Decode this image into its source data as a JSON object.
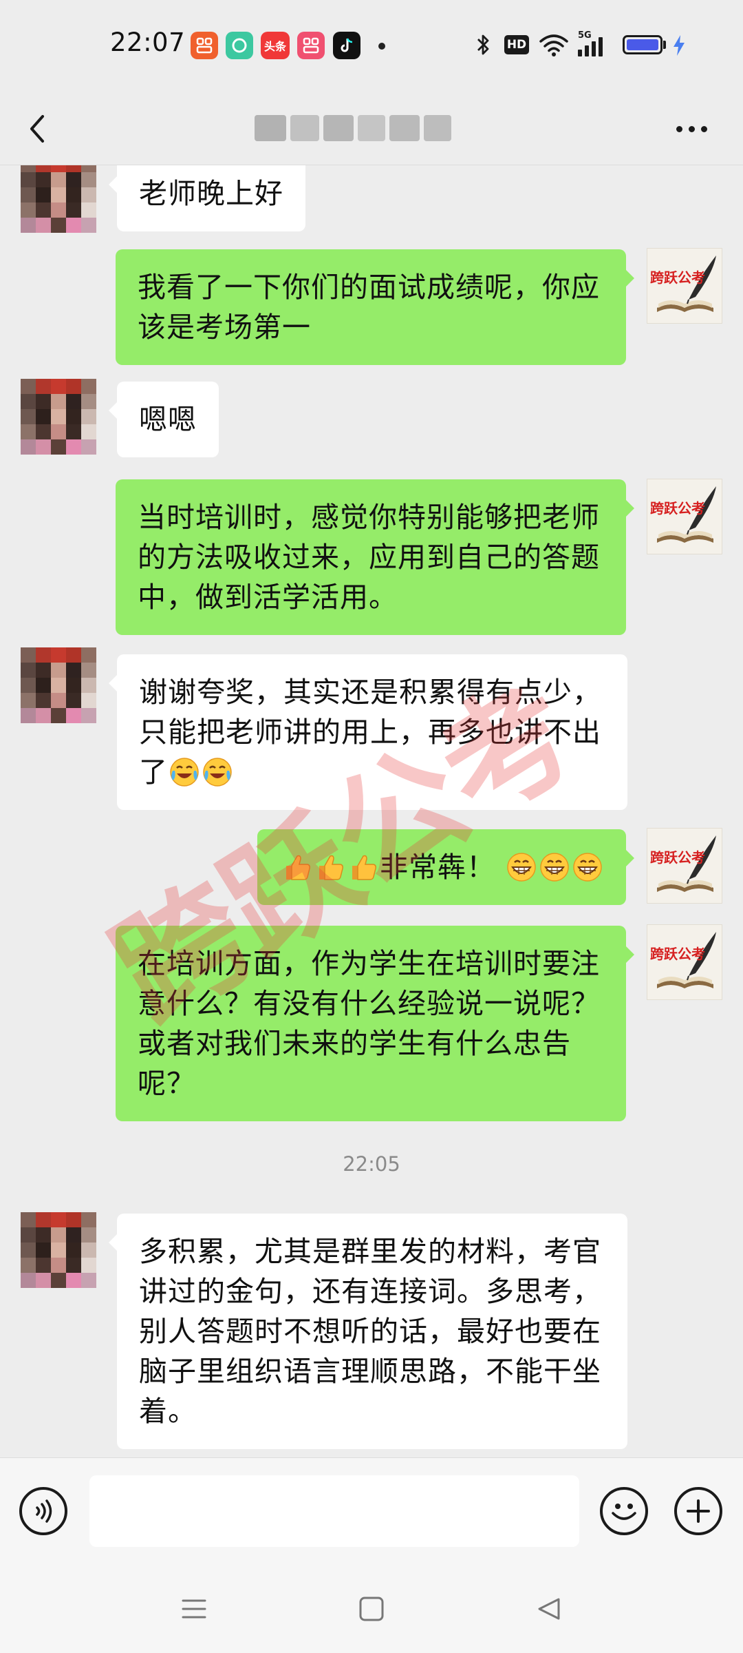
{
  "status_bar": {
    "time": "22:07",
    "app_icons": [
      {
        "name": "app-icon-1",
        "label": "",
        "color": "#f0602d"
      },
      {
        "name": "app-icon-2",
        "label": "",
        "color": "#3cc8a0"
      },
      {
        "name": "toutiao-app-icon",
        "label": "头条",
        "color": "#f03838"
      },
      {
        "name": "app-icon-4",
        "label": "",
        "color": "#f05070"
      },
      {
        "name": "tiktok-icon",
        "label": "",
        "color": "#111111"
      }
    ],
    "hd_label": "HD",
    "network_label": "5G",
    "battery_level": 0.95,
    "battery_color": "#4a5ae8"
  },
  "header": {
    "title": "",
    "back_icon": "chevron-left-icon",
    "more_icon": "more-horizontal-icon"
  },
  "messages": [
    {
      "side": "in",
      "text": "老师晚上好"
    },
    {
      "side": "out",
      "text": "我看了一下你们的面试成绩呢，你应该是考场第一"
    },
    {
      "side": "in",
      "text": "嗯嗯"
    },
    {
      "side": "out",
      "text": "当时培训时，感觉你特别能够把老师的方法吸收过来，应用到自己的答题中，做到活学活用。"
    },
    {
      "side": "in",
      "text": "谢谢夸奖，其实还是积累得有点少，只能把老师讲的用上，再多也讲不出了",
      "emojis": [
        "laugh-cry-emoji",
        "laugh-cry-emoji"
      ]
    },
    {
      "side": "out",
      "text": "非常犇！",
      "prefix_emojis": [
        "thumbs-up-emoji",
        "thumbs-up-emoji",
        "thumbs-up-emoji"
      ],
      "emojis": [
        "grin-emoji",
        "grin-emoji",
        "grin-emoji"
      ]
    },
    {
      "side": "out",
      "text": "在培训方面，作为学生在培训时要注意什么？有没有什么经验说一说呢？或者对我们未来的学生有什么忠告呢？"
    },
    {
      "side": "in",
      "text": "多积累，尤其是群里发的材料，考官讲过的金句，还有连接词。多思考，别人答题时不想听的话，最好也要在脑子里组织语言理顺思路，不能干坐着。"
    }
  ],
  "timestamp": "22:05",
  "avatars": {
    "teacher_brand": "跨跃公考"
  },
  "watermark": {
    "text": "跨跃公考",
    "color": "#e83a3a"
  },
  "input_bar": {
    "placeholder": "",
    "voice_icon": "voice-icon",
    "emoji_icon": "emoji-icon",
    "plus_icon": "plus-icon"
  },
  "nav_bar": {
    "menu_icon": "menu-icon",
    "home_icon": "home-icon",
    "back_icon": "back-triangle-icon"
  },
  "colors": {
    "background": "#ededed",
    "bubble_out": "#95ec69",
    "bubble_in": "#ffffff"
  }
}
